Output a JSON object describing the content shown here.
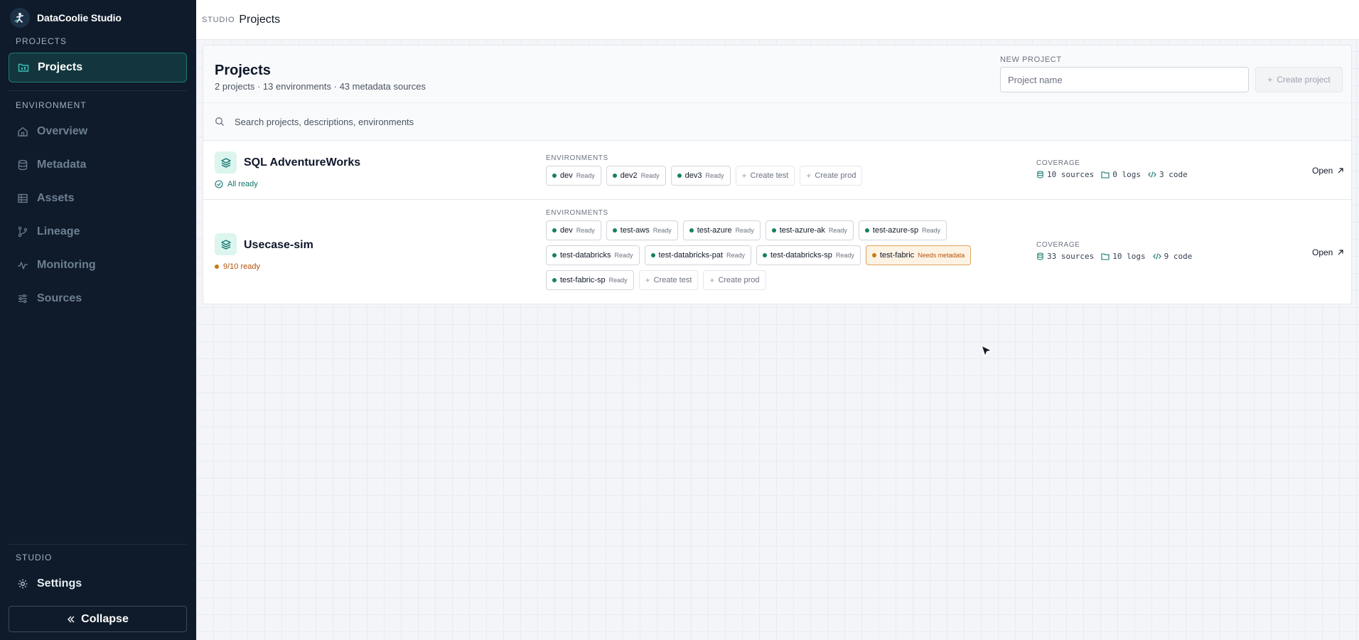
{
  "app": {
    "name": "DataCoolie Studio"
  },
  "sidebar": {
    "section_projects": "PROJECTS",
    "projects_item": "Projects",
    "section_environment": "ENVIRONMENT",
    "env_items": [
      {
        "label": "Overview",
        "icon": "home-icon"
      },
      {
        "label": "Metadata",
        "icon": "database-icon"
      },
      {
        "label": "Assets",
        "icon": "table-icon"
      },
      {
        "label": "Lineage",
        "icon": "branch-icon"
      },
      {
        "label": "Monitoring",
        "icon": "activity-icon"
      },
      {
        "label": "Sources",
        "icon": "sliders-icon"
      }
    ],
    "section_studio": "STUDIO",
    "settings_item": "Settings",
    "collapse_label": "Collapse"
  },
  "topbar": {
    "crumb": "STUDIO",
    "title": "Projects"
  },
  "panel": {
    "title": "Projects",
    "subtitle": "2 projects · 13 environments · 43 metadata sources",
    "new_project_label": "NEW PROJECT",
    "new_project_placeholder": "Project name",
    "create_button": "Create project",
    "search_placeholder": "Search projects, descriptions, environments"
  },
  "projects": [
    {
      "name": "SQL AdventureWorks",
      "status": "All ready",
      "env_label": "ENVIRONMENTS",
      "environments": [
        {
          "name": "dev",
          "status": "Ready"
        },
        {
          "name": "dev2",
          "status": "Ready"
        },
        {
          "name": "dev3",
          "status": "Ready"
        }
      ],
      "create_test": "Create test",
      "create_prod": "Create prod",
      "coverage_label": "COVERAGE",
      "sources": "10 sources",
      "logs": "0 logs",
      "code": "3 code",
      "open": "Open"
    },
    {
      "name": "Usecase-sim",
      "status": "9/10 ready",
      "env_label": "ENVIRONMENTS",
      "environments": [
        {
          "name": "dev",
          "status": "Ready"
        },
        {
          "name": "test-aws",
          "status": "Ready"
        },
        {
          "name": "test-azure",
          "status": "Ready"
        },
        {
          "name": "test-azure-ak",
          "status": "Ready"
        },
        {
          "name": "test-azure-sp",
          "status": "Ready"
        },
        {
          "name": "test-databricks",
          "status": "Ready"
        },
        {
          "name": "test-databricks-pat",
          "status": "Ready"
        },
        {
          "name": "test-databricks-sp",
          "status": "Ready"
        },
        {
          "name": "test-fabric",
          "status": "Needs metadata"
        },
        {
          "name": "test-fabric-sp",
          "status": "Ready"
        }
      ],
      "create_test": "Create test",
      "create_prod": "Create prod",
      "coverage_label": "COVERAGE",
      "sources": "33 sources",
      "logs": "10 logs",
      "code": "9 code",
      "open": "Open"
    }
  ],
  "colors": {
    "sidebar_bg": "#0f1b2a",
    "accent": "#1e7b73",
    "ready": "#16825d",
    "warn": "#c77a17"
  }
}
